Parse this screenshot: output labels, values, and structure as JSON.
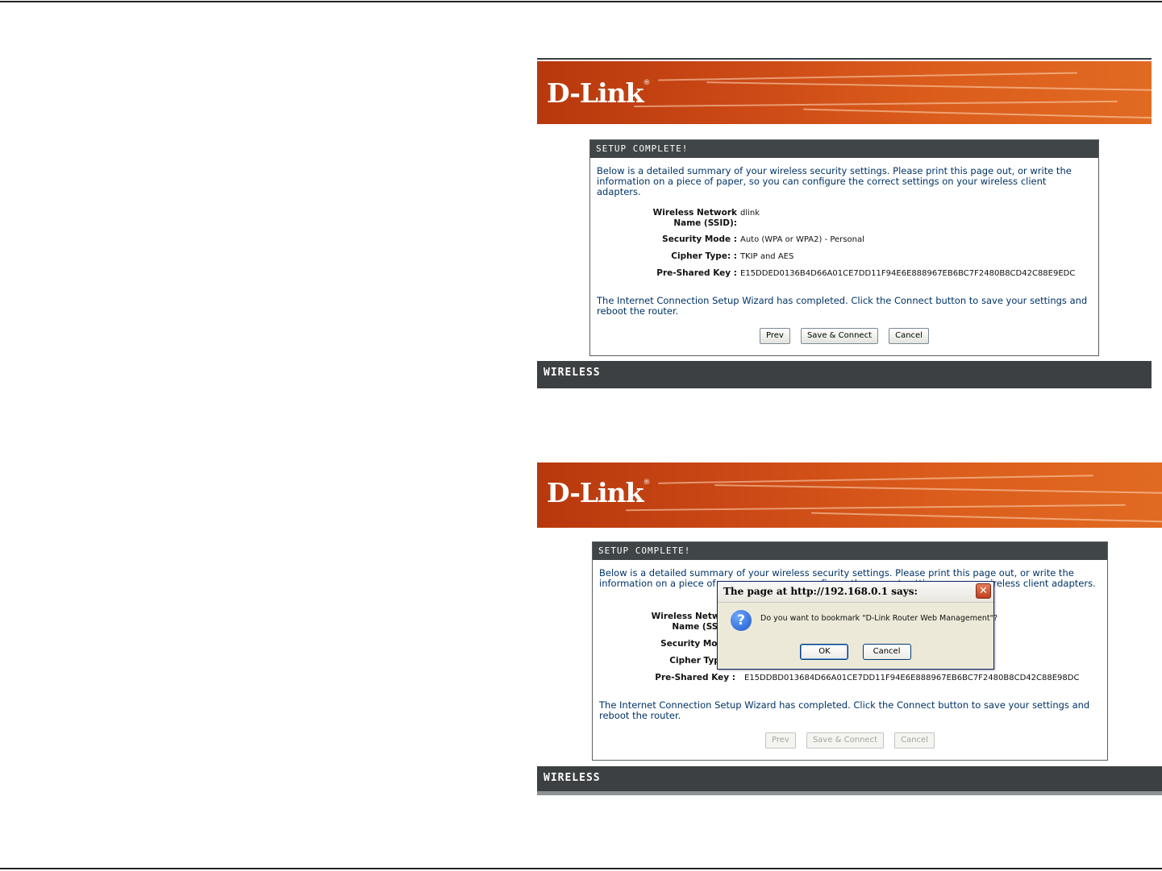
{
  "shot1": {
    "logo": "D-Link",
    "setup_title": "SETUP COMPLETE!",
    "intro": "Below is a detailed summary of your wireless security settings. Please print this page out, or write the information on a piece of paper, so you can configure the correct settings on your wireless client adapters.",
    "fields": [
      {
        "label": "Wireless Network Name (SSID):",
        "value": "dlink"
      },
      {
        "label": "Security Mode :",
        "value": "Auto (WPA or WPA2) - Personal"
      },
      {
        "label": "Cipher Type: :",
        "value": "TKIP and AES"
      },
      {
        "label": "Pre-Shared Key :",
        "value": "E15DDED0136B4D66A01CE7DD11F94E6E888967EB6BC7F2480B8CD42C88E9EDC"
      }
    ],
    "outro": "The Internet Connection Setup Wizard has completed. Click the Connect button to save your settings and reboot the router.",
    "buttons": {
      "prev": "Prev",
      "save_connect": "Save & Connect",
      "cancel": "Cancel"
    },
    "footer": "WIRELESS"
  },
  "shot2": {
    "logo": "D-Link",
    "setup_title": "SETUP COMPLETE!",
    "intro": "Below is a detailed summary of your wireless security settings. Please print this page out, or write the information on a piece of paper, so you can configure the correct settings on your wireless client adapters.",
    "fields": [
      {
        "label": "Wireless Network Name (SSID):",
        "value": ""
      },
      {
        "label": "Security Mode :",
        "value": ""
      },
      {
        "label": "Cipher Type: :",
        "value": ""
      },
      {
        "label": "Pre-Shared Key :",
        "value": "E15DDBD013684D66A01CE7DD11F94E6E888967EB6BC7F2480B8CD42C88E98DC"
      }
    ],
    "outro": "The Internet Connection Setup Wizard has completed. Click the Connect button to save your settings and reboot the router.",
    "buttons": {
      "prev": "Prev",
      "save_connect": "Save & Connect",
      "cancel": "Cancel"
    },
    "footer": "WIRELESS",
    "dialog": {
      "title": "The page at http://192.168.0.1 says:",
      "message": "Do you want to bookmark \"D-Link Router Web Management\"?",
      "ok": "OK",
      "cancel": "Cancel",
      "icon": "question-icon"
    }
  },
  "colors": {
    "banner_orange": "#cc4a16",
    "dark_bar": "#3c4042",
    "text_blue": "#003366"
  }
}
